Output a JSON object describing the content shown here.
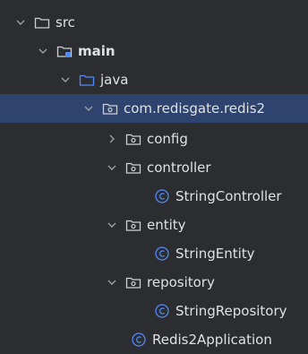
{
  "colors": {
    "background": "#2b2d30",
    "selection": "#2e436e",
    "text": "#dfe1e5",
    "folder_icon": "#ced0d6",
    "source_folder_icon": "#548af7",
    "class_icon": "#548af7"
  },
  "tree": {
    "nodes": [
      {
        "label": "src",
        "icon": "folder-icon",
        "expanded": true
      },
      {
        "label": "main",
        "icon": "module-folder-icon",
        "expanded": true
      },
      {
        "label": "java",
        "icon": "source-folder-icon",
        "expanded": true
      },
      {
        "label": "com.redisgate.redis2",
        "icon": "package-icon",
        "expanded": true,
        "selected": true
      },
      {
        "label": "config",
        "icon": "package-icon",
        "expanded": false
      },
      {
        "label": "controller",
        "icon": "package-icon",
        "expanded": true
      },
      {
        "label": "StringController",
        "icon": "class-icon"
      },
      {
        "label": "entity",
        "icon": "package-icon",
        "expanded": true
      },
      {
        "label": "StringEntity",
        "icon": "class-icon"
      },
      {
        "label": "repository",
        "icon": "package-icon",
        "expanded": true
      },
      {
        "label": "StringRepository",
        "icon": "class-icon"
      },
      {
        "label": "Redis2Application",
        "icon": "class-icon"
      }
    ]
  }
}
